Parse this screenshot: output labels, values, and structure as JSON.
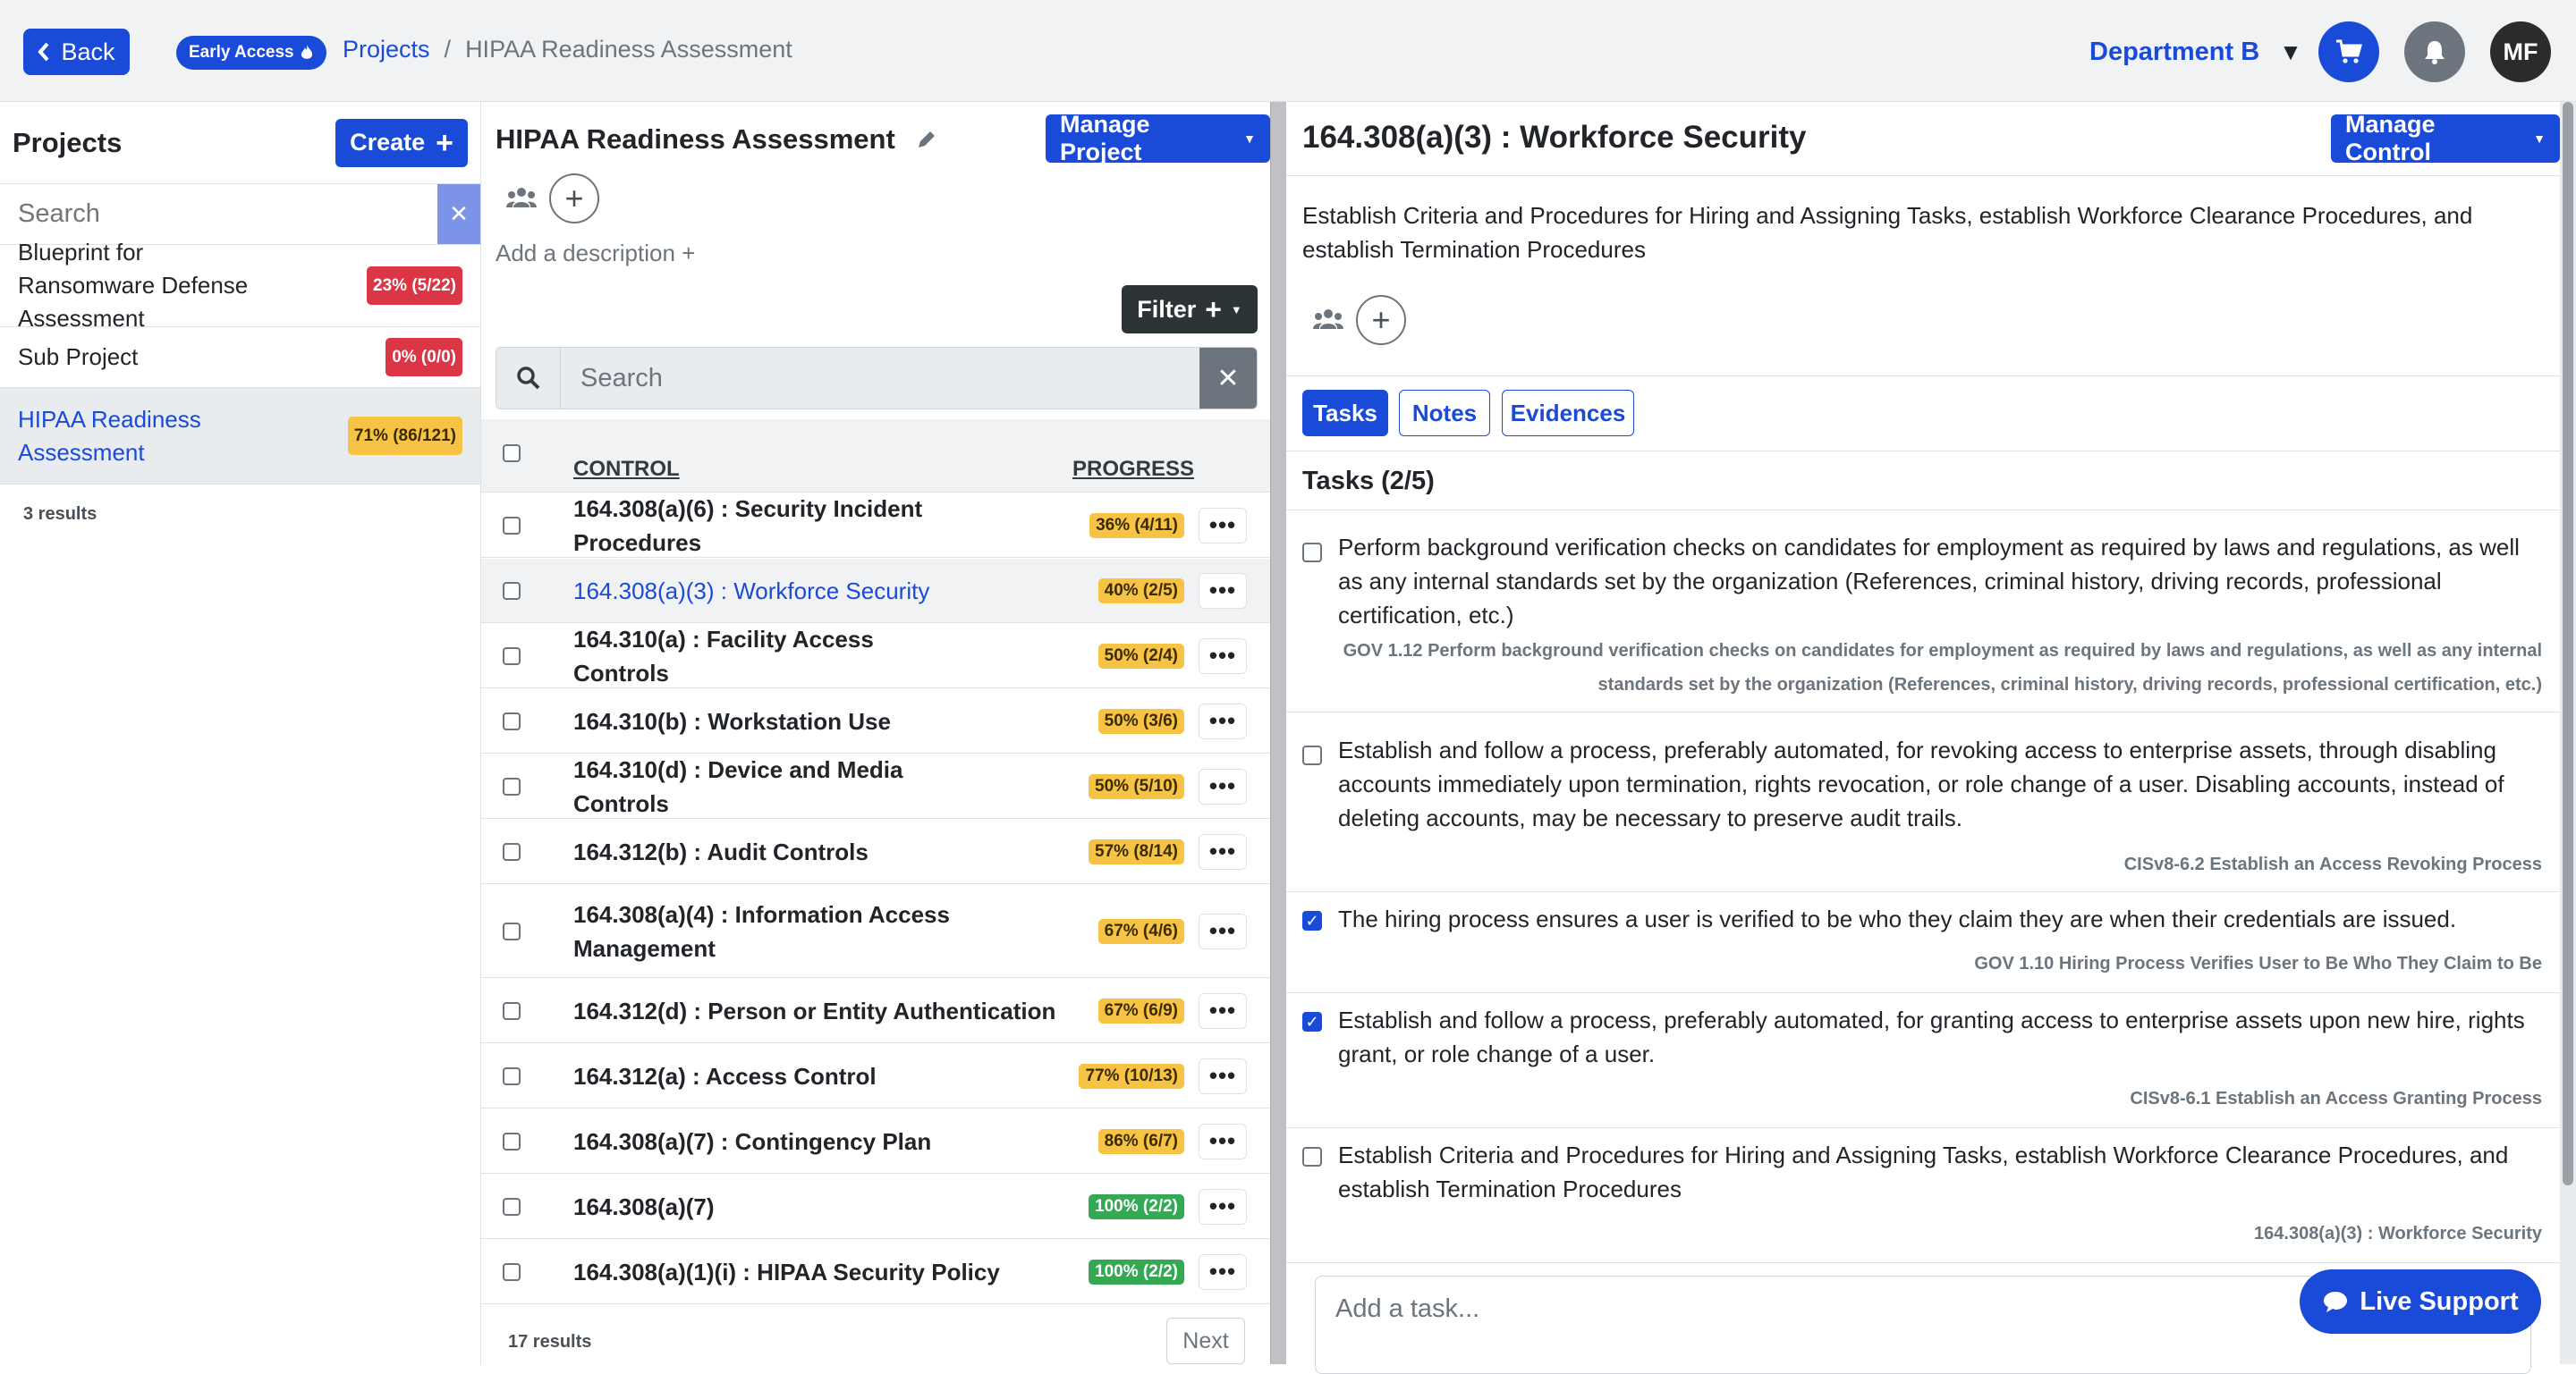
{
  "header": {
    "back_label": "Back",
    "early_access_label": "Early Access",
    "breadcrumb_root": "Projects",
    "breadcrumb_sep": "/",
    "breadcrumb_current": "HIPAA Readiness Assessment",
    "department": "Department B",
    "avatar_initials": "MF",
    "icons": [
      "chevron-left-icon",
      "flame-icon",
      "caret-down-icon",
      "cart-icon",
      "bell-icon"
    ]
  },
  "sidebar": {
    "title": "Projects",
    "create_label": "Create",
    "search_placeholder": "Search",
    "projects": [
      {
        "name": "Blueprint for Ransomware Defense Assessment",
        "progress": "23% (5/22)",
        "color": "#dc3545"
      },
      {
        "name": "Sub Project",
        "progress": "0% (0/0)",
        "color": "#dc3545"
      },
      {
        "name": "HIPAA Readiness Assessment",
        "progress": "71% (86/121)",
        "color": "#f6c344",
        "active": true
      }
    ],
    "results": "3 results"
  },
  "project": {
    "title": "HIPAA Readiness Assessment",
    "manage_label": "Manage Project",
    "add_description": "Add a description +",
    "filter_label": "Filter",
    "search_placeholder": "Search",
    "col_control": "CONTROL",
    "col_progress": "PROGRESS",
    "controls": [
      {
        "name": "164.308(a)(6) : Security Incident Procedures",
        "progress": "36% (4/11)",
        "status": "yellow"
      },
      {
        "name": "164.308(a)(3) : Workforce Security",
        "progress": "40% (2/5)",
        "status": "yellow",
        "active": true
      },
      {
        "name": "164.310(a) : Facility Access Controls",
        "progress": "50% (2/4)",
        "status": "yellow"
      },
      {
        "name": "164.310(b) : Workstation Use",
        "progress": "50% (3/6)",
        "status": "yellow"
      },
      {
        "name": "164.310(d) : Device and Media Controls",
        "progress": "50% (5/10)",
        "status": "yellow"
      },
      {
        "name": "164.312(b) : Audit Controls",
        "progress": "57% (8/14)",
        "status": "yellow"
      },
      {
        "name": "164.308(a)(4) : Information Access Management",
        "progress": "67% (4/6)",
        "status": "yellow"
      },
      {
        "name": "164.312(d) : Person or Entity Authentication",
        "progress": "67% (6/9)",
        "status": "yellow"
      },
      {
        "name": "164.312(a) : Access Control",
        "progress": "77% (10/13)",
        "status": "yellow"
      },
      {
        "name": "164.308(a)(7) : Contingency Plan",
        "progress": "86% (6/7)",
        "status": "yellow"
      },
      {
        "name": "164.308(a)(7)",
        "progress": "100% (2/2)",
        "status": "green"
      },
      {
        "name": "164.308(a)(1)(i) : HIPAA Security Policy",
        "progress": "100% (2/2)",
        "status": "green"
      }
    ],
    "more_label": "•••",
    "results": "17 results",
    "next_label": "Next"
  },
  "control": {
    "title": "164.308(a)(3) : Workforce Security",
    "manage_label": "Manage Control",
    "description": "Establish Criteria and Procedures for Hiring and Assigning Tasks, establish Workforce Clearance Procedures, and establish Termination Procedures",
    "tabs": [
      "Tasks",
      "Notes",
      "Evidences"
    ],
    "tasks_heading": "Tasks (2/5)",
    "tasks": [
      {
        "text": "Perform background verification checks on candidates for employment as required by laws and regulations, as well as any internal standards set by the organization (References, criminal history, driving records, professional certification, etc.)",
        "ref": "GOV 1.12 Perform background verification checks on candidates for employment as required by laws and regulations, as well as any internal standards set by the organization (References, criminal history, driving records, professional certification, etc.)",
        "checked": false
      },
      {
        "text": "Establish and follow a process, preferably automated, for revoking access to enterprise assets, through disabling accounts immediately upon termination, rights revocation, or role change of a user. Disabling accounts, instead of deleting accounts, may be necessary to preserve audit trails.",
        "ref": "CISv8-6.2 Establish an Access Revoking Process",
        "checked": false
      },
      {
        "text": "The hiring process ensures a user is verified to be who they claim they are when their credentials are issued.",
        "ref": "GOV 1.10 Hiring Process Verifies User to Be Who They Claim to Be",
        "checked": true
      },
      {
        "text": "Establish and follow a process, preferably automated, for granting access to enterprise assets upon new hire, rights grant, or role change of a user.",
        "ref": "CISv8-6.1 Establish an Access Granting Process",
        "checked": true
      },
      {
        "text": "Establish Criteria and Procedures for Hiring and Assigning Tasks, establish Workforce Clearance Procedures, and establish Termination Procedures",
        "ref": "164.308(a)(3) : Workforce Security",
        "checked": false
      }
    ],
    "add_task_placeholder": "Add a task..."
  },
  "support": {
    "label": "Live Support"
  }
}
